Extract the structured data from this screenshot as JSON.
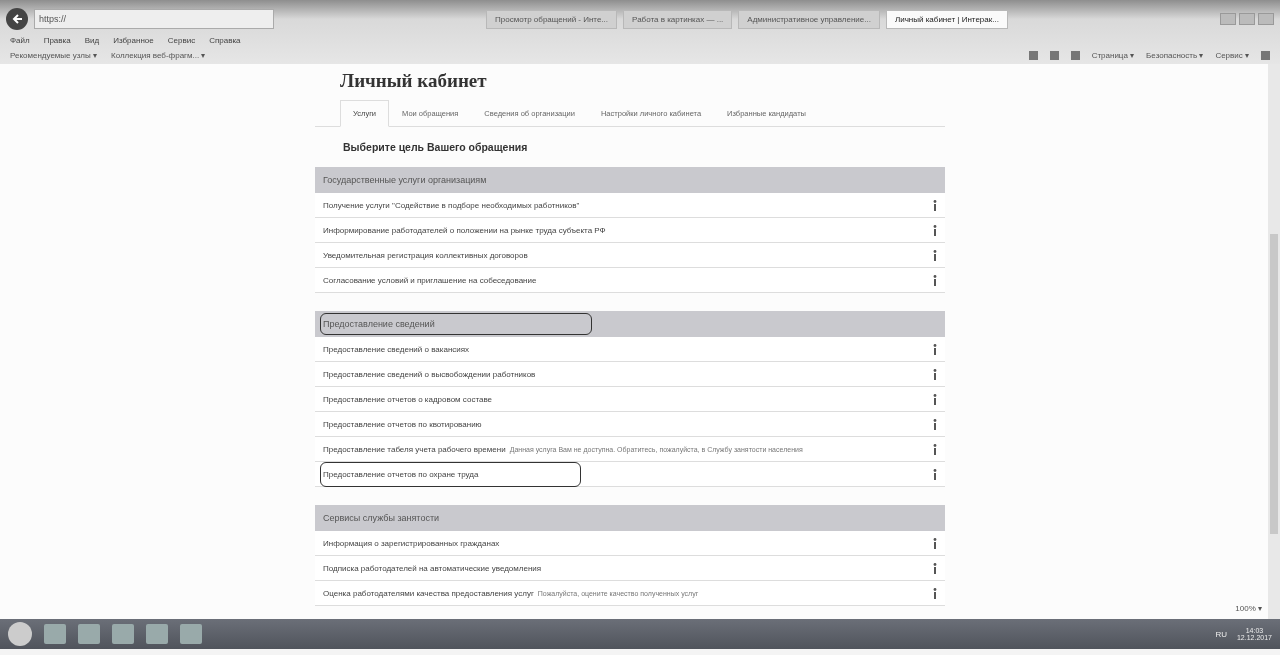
{
  "browser": {
    "address": "https://",
    "tabs": [
      {
        "label": "Просмотр обращений - Инте...",
        "selected": false
      },
      {
        "label": "Работа в картинках — ...",
        "selected": false
      },
      {
        "label": "Административное управление...",
        "selected": false
      },
      {
        "label": "Личный кабинет | Интерак...",
        "selected": true
      }
    ],
    "menu": [
      "Файл",
      "Правка",
      "Вид",
      "Избранное",
      "Сервис",
      "Справка"
    ],
    "favorites": [
      "Рекомендуемые узлы ▾",
      "Коллекция веб-фрагм... ▾"
    ],
    "commands": [
      "Страница ▾",
      "Безопасность ▾",
      "Сервис ▾"
    ]
  },
  "page": {
    "title": "Личный кабинет",
    "tabs": [
      {
        "label": "Услуги",
        "selected": true
      },
      {
        "label": "Мои обращения",
        "selected": false
      },
      {
        "label": "Сведения об организации",
        "selected": false
      },
      {
        "label": "Настройки личного кабинета",
        "selected": false
      },
      {
        "label": "Избранные кандидаты",
        "selected": false
      }
    ],
    "heading": "Выберите цель Вашего обращения",
    "sections": [
      {
        "title": "Государственные услуги организациям",
        "highlighted": false,
        "items": [
          {
            "label": "Получение услуги \"Содействие в подборе необходимых работников\"",
            "highlighted": false
          },
          {
            "label": "Информирование работодателей о положении на рынке труда субъекта РФ",
            "highlighted": false
          },
          {
            "label": "Уведомительная регистрация коллективных договоров",
            "highlighted": false
          },
          {
            "label": "Согласование условий и приглашение на собеседование",
            "highlighted": false
          }
        ]
      },
      {
        "title": "Предоставление сведений",
        "highlighted": true,
        "items": [
          {
            "label": "Предоставление сведений о вакансиях",
            "highlighted": false
          },
          {
            "label": "Предоставление сведений о высвобождении работников",
            "highlighted": false
          },
          {
            "label": "Предоставление отчетов о кадровом составе",
            "highlighted": false
          },
          {
            "label": "Предоставление отчетов по квотированию",
            "highlighted": false
          },
          {
            "label": "Предоставление табеля учета рабочего времени",
            "note": "Данная услуга Вам не доступна. Обратитесь, пожалуйста, в Службу занятости населения",
            "highlighted": false
          },
          {
            "label": "Предоставление отчетов по охране труда",
            "highlighted": true
          }
        ]
      },
      {
        "title": "Сервисы службы занятости",
        "highlighted": false,
        "items": [
          {
            "label": "Информация о зарегистрированных гражданах",
            "highlighted": false
          },
          {
            "label": "Подписка работодателей на автоматические уведомления",
            "highlighted": false
          },
          {
            "label": "Оценка работодателями качества предоставления услуг",
            "note": "Пожалуйста, оцените качество полученных услуг",
            "highlighted": false
          }
        ]
      }
    ]
  },
  "status_bar": {
    "zoom": "100% ▾"
  },
  "taskbar": {
    "language": "RU",
    "time": "14:03",
    "date": "12.12.2017"
  }
}
